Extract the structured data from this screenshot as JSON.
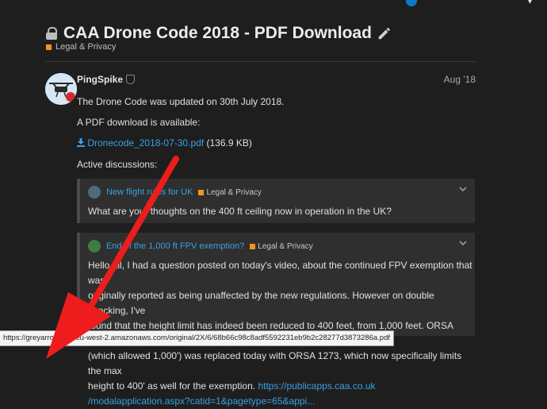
{
  "topic": {
    "title": "CAA Drone Code 2018 - PDF Download",
    "category": "Legal & Privacy",
    "category_color": "#f0961e"
  },
  "post": {
    "author": "PingSpike",
    "date": "Aug '18",
    "line1": "The Drone Code was updated on 30th July 2018.",
    "line2": "A PDF download is available:",
    "file_link": "Dronecode_2018-07-30.pdf",
    "file_size": "(136.9 KB)",
    "line3": "Active discussions:"
  },
  "quotes": [
    {
      "title": "New flight rules for UK",
      "category": "Legal & Privacy",
      "body": "What are your thoughts on the 400 ft ceiling now in operation in the UK?"
    },
    {
      "title": "End of the 1,000 ft FPV exemption?",
      "category": "Legal & Privacy",
      "body_lines": [
        "Hello all, I had a question posted on today's video, about the continued FPV exemption that was",
        "originally reported as being unaffected by the new regulations. However on double checking, I've",
        "found that the height limit has indeed been reduced to 400 feet, from 1,000 feet. ORSA 1226",
        "(which allowed 1,000') was replaced today with ORSA 1273, which now specifically limits the max",
        "height to 400' as well for the exemption."
      ],
      "link_part1": "https://publicapps.caa.co.uk",
      "link_part2": "/modalapplication.aspx?catid=1&pagetype=65&appi..."
    }
  ],
  "statusbar": {
    "url": "https://greyarrows.s3-eu-west-2.amazonaws.com/original/2X/6/68b66c98c8adf5592231eb9b2c28277d3873286a.pdf"
  }
}
